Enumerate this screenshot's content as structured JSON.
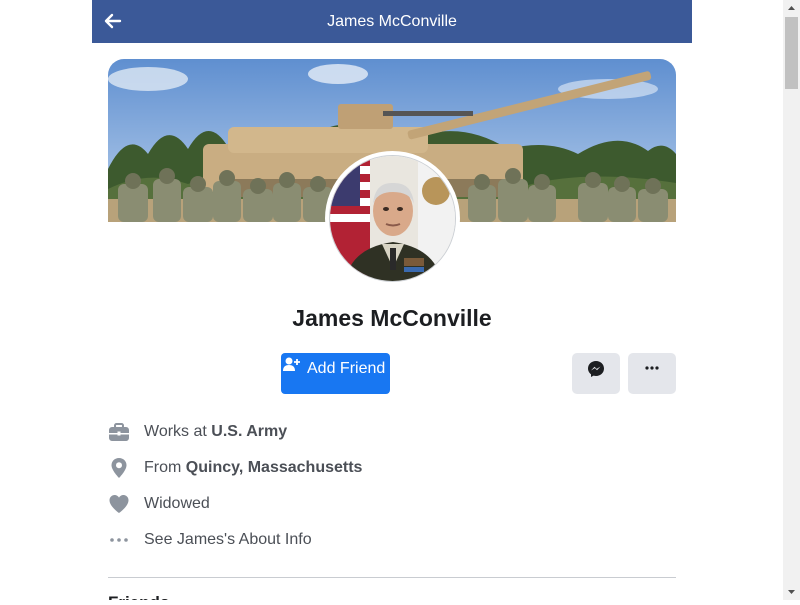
{
  "header": {
    "title": "James McConville",
    "back_icon": "arrow-left-icon",
    "background_color": "#3b5998"
  },
  "profile": {
    "name": "James McConville",
    "cover_icon": "cover-photo",
    "avatar_icon": "profile-picture"
  },
  "actions": {
    "add_friend_label": "Add Friend",
    "add_friend_icon": "add-person-icon",
    "messenger_icon": "messenger-icon",
    "more_icon": "more-dots-icon",
    "primary_color": "#1877f2"
  },
  "intro": {
    "work": {
      "icon": "briefcase-icon",
      "prefix": "Works at ",
      "value": "U.S. Army"
    },
    "from": {
      "icon": "location-pin-icon",
      "prefix": "From ",
      "value": "Quincy, Massachusetts"
    },
    "relationship": {
      "icon": "heart-icon",
      "text": "Widowed"
    },
    "about": {
      "icon": "more-dots-icon",
      "text": "See James's About Info"
    }
  },
  "sections": {
    "next_heading": "Friends"
  }
}
